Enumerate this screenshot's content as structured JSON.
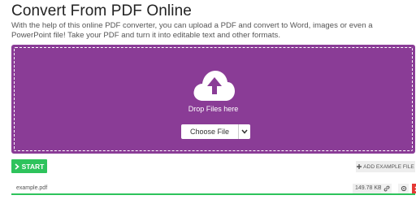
{
  "header": {
    "title": "Convert From PDF Online",
    "description": "With the help of this online PDF converter, you can upload a PDF and convert to Word, images or even a PowerPoint file! Take your PDF and turn it into editable text and other formats."
  },
  "dropzone": {
    "text": "Drop Files here",
    "choose_label": "Choose File",
    "background": "#8a3c96"
  },
  "actions": {
    "start_label": "START",
    "add_example_label": "ADD EXAMPLE FILE",
    "start_color": "#2ec35c"
  },
  "file": {
    "name": "example.pdf",
    "size": "149.78 KB"
  },
  "icons": [
    "upload-cloud-icon",
    "chevron-down-icon",
    "chevron-right-icon",
    "plus-icon",
    "link-icon",
    "settings-icon",
    "close-icon"
  ]
}
